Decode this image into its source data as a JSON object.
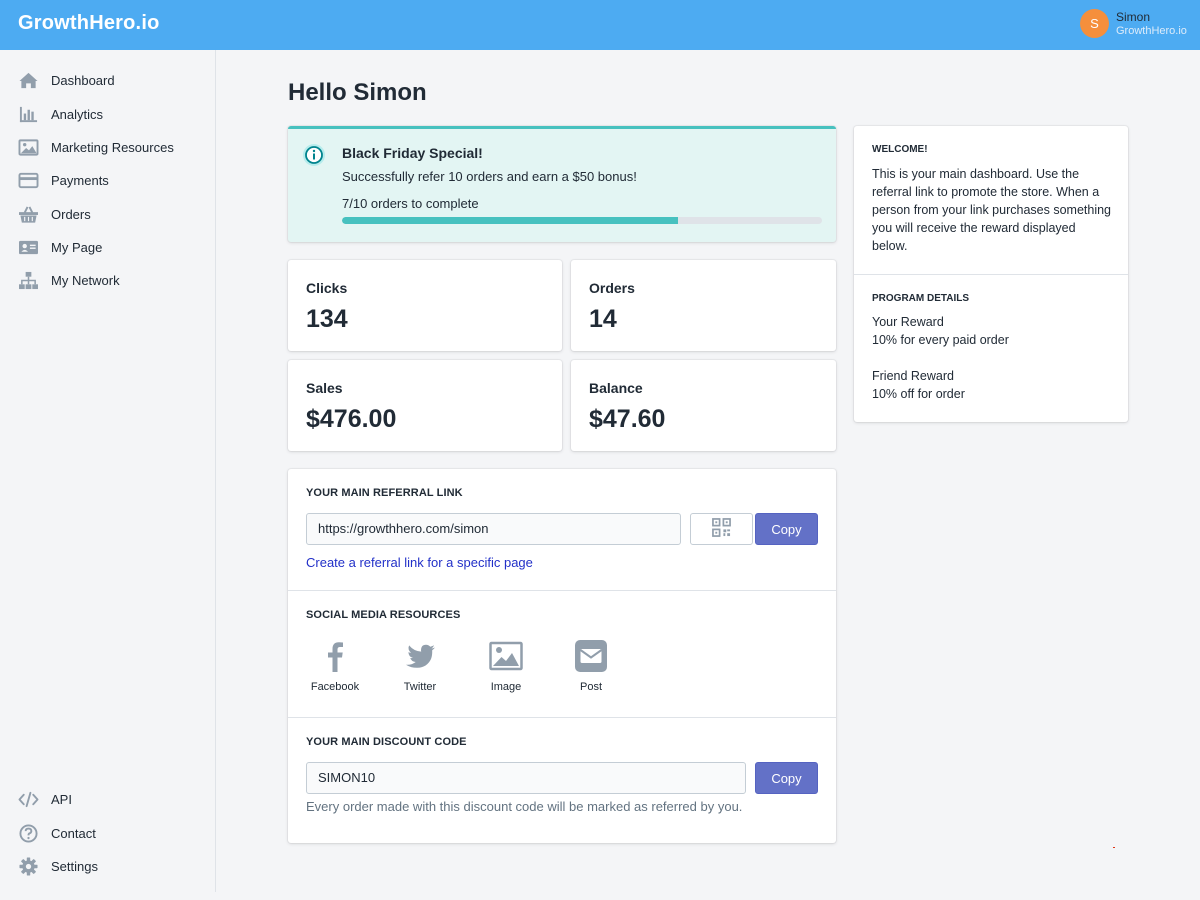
{
  "app": {
    "brand": "GrowthHero.io",
    "user": {
      "initial": "S",
      "name": "Simon",
      "subtitle": "GrowthHero.io"
    }
  },
  "sidebar": {
    "items": [
      {
        "label": "Dashboard",
        "icon": "home-icon"
      },
      {
        "label": "Analytics",
        "icon": "bar-chart-icon"
      },
      {
        "label": "Marketing Resources",
        "icon": "image-icon"
      },
      {
        "label": "Payments",
        "icon": "credit-card-icon"
      },
      {
        "label": "Orders",
        "icon": "basket-icon"
      },
      {
        "label": "My Page",
        "icon": "profile-card-icon"
      },
      {
        "label": "My Network",
        "icon": "network-icon"
      }
    ],
    "bottom_items": [
      {
        "label": "API",
        "icon": "code-icon"
      },
      {
        "label": "Contact",
        "icon": "question-icon"
      },
      {
        "label": "Settings",
        "icon": "gear-icon"
      }
    ]
  },
  "main": {
    "greeting": "Hello Simon",
    "banner": {
      "title": "Black Friday Special!",
      "text": "Successfully refer 10 orders and earn a $50 bonus!",
      "progress_label": "7/10 orders to complete",
      "progress": 0.7,
      "icon": "info-icon"
    },
    "stats": [
      {
        "label": "Clicks",
        "value": "134"
      },
      {
        "label": "Orders",
        "value": "14"
      },
      {
        "label": "Sales",
        "value": "$476.00"
      },
      {
        "label": "Balance",
        "value": "$47.60"
      }
    ],
    "referral": {
      "heading": "YOUR MAIN REFERRAL LINK",
      "url": "https://growthhero.com/simon",
      "copy_label": "Copy",
      "create_link": "Create a referral link for a specific page"
    },
    "social": {
      "heading": "SOCIAL MEDIA RESOURCES",
      "items": [
        {
          "label": "Facebook",
          "icon": "facebook-icon"
        },
        {
          "label": "Twitter",
          "icon": "twitter-icon"
        },
        {
          "label": "Image",
          "icon": "image-icon"
        },
        {
          "label": "Post",
          "icon": "mail-icon"
        }
      ]
    },
    "discount": {
      "heading": "YOUR MAIN DISCOUNT CODE",
      "code": "SIMON10",
      "copy_label": "Copy",
      "helper": "Every order made with this discount code will be marked as referred by you."
    }
  },
  "aside": {
    "welcome_heading": "WELCOME!",
    "welcome_text": "This is your main dashboard. Use the referral link to promote the store. When a person from your link purchases something you will receive the reward displayed below.",
    "program_heading": "PROGRAM DETAILS",
    "your_reward_label": "Your Reward",
    "your_reward_value": "10% for every paid order",
    "friend_reward_label": "Friend Reward",
    "friend_reward_value": "10% off for order"
  },
  "colors": {
    "topbar": "#4dabf2",
    "accent": "#6371c7",
    "teal": "#47c1bf",
    "avatar": "#f58f3c",
    "link": "#2230c8"
  }
}
